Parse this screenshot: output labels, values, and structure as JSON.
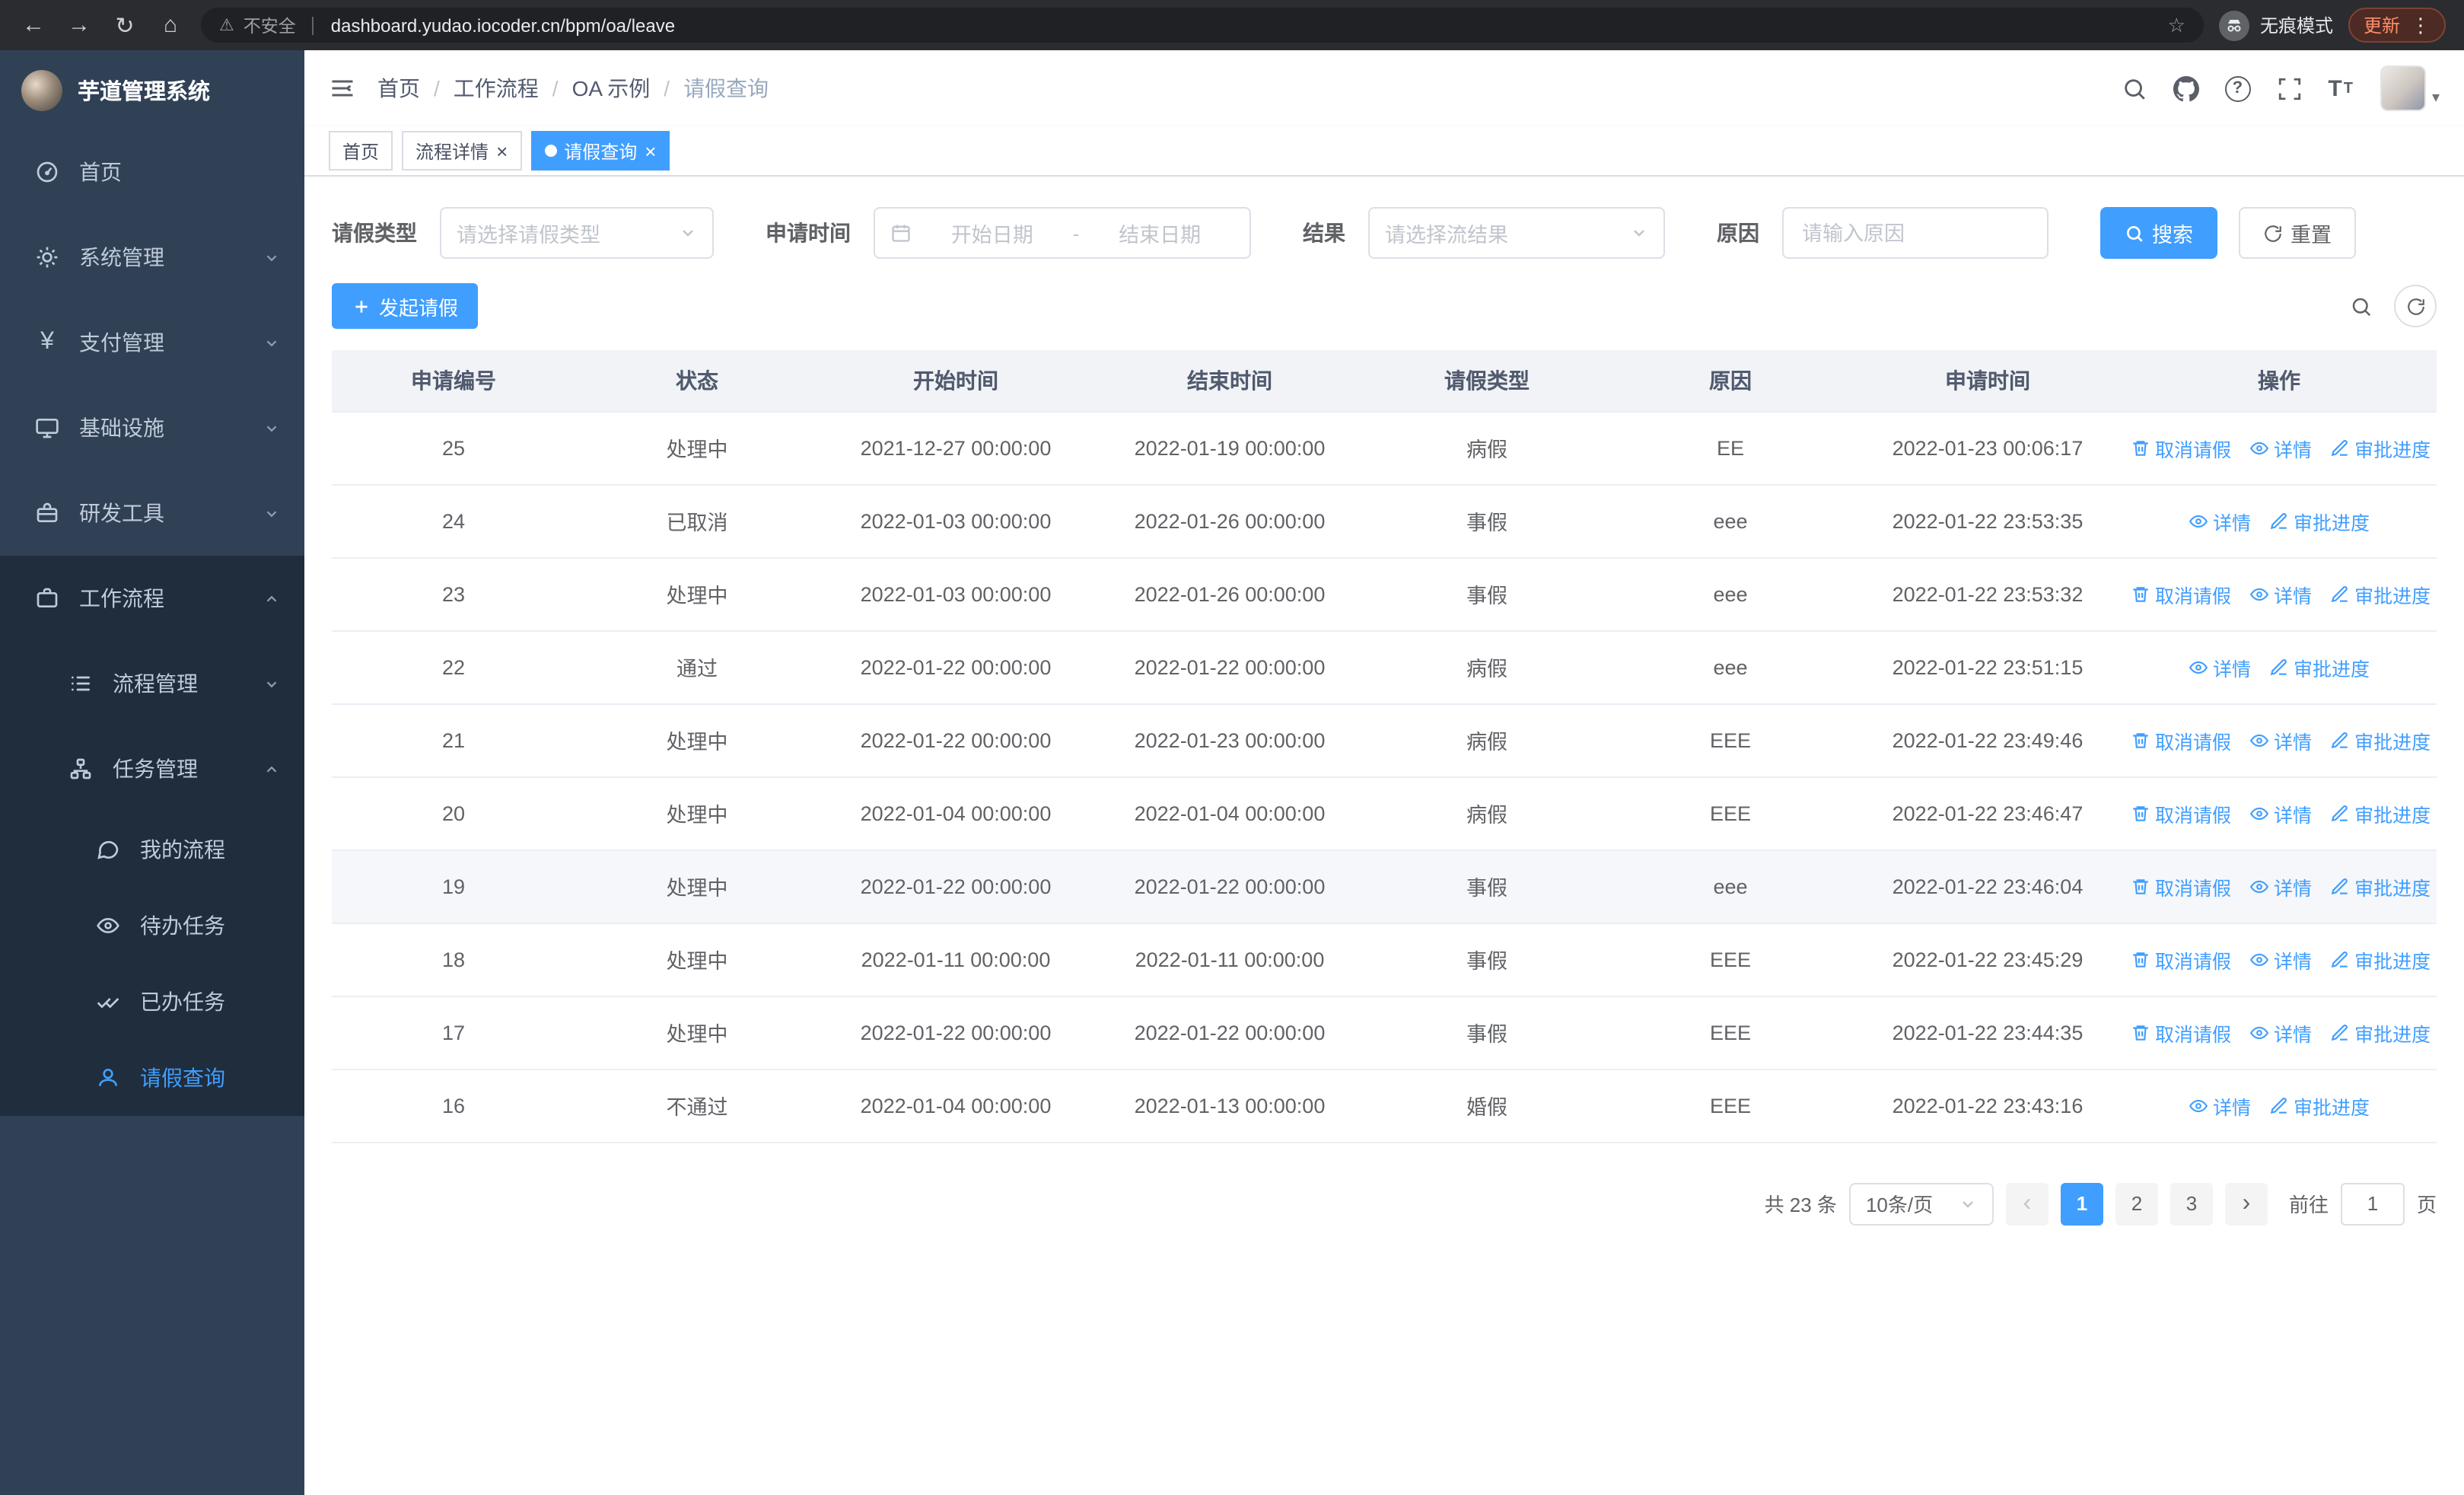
{
  "browser": {
    "warning": "不安全",
    "url": "dashboard.yudao.iocoder.cn/bpm/oa/leave",
    "incognito": "无痕模式",
    "update": "更新"
  },
  "sidebar": {
    "title": "芋道管理系统",
    "items": [
      {
        "label": "首页"
      },
      {
        "label": "系统管理"
      },
      {
        "label": "支付管理"
      },
      {
        "label": "基础设施"
      },
      {
        "label": "研发工具"
      },
      {
        "label": "工作流程"
      },
      {
        "label": "流程管理"
      },
      {
        "label": "任务管理"
      },
      {
        "label": "我的流程"
      },
      {
        "label": "待办任务"
      },
      {
        "label": "已办任务"
      },
      {
        "label": "请假查询"
      }
    ]
  },
  "breadcrumb": [
    "首页",
    "工作流程",
    "OA 示例",
    "请假查询"
  ],
  "tabs": [
    {
      "label": "首页",
      "closable": false,
      "active": false
    },
    {
      "label": "流程详情",
      "closable": true,
      "active": false
    },
    {
      "label": "请假查询",
      "closable": true,
      "active": true
    }
  ],
  "filters": {
    "leave_type_label": "请假类型",
    "leave_type_placeholder": "请选择请假类型",
    "apply_time_label": "申请时间",
    "start_date_placeholder": "开始日期",
    "date_separator": "-",
    "end_date_placeholder": "结束日期",
    "result_label": "结果",
    "result_placeholder": "请选择流结果",
    "reason_label": "原因",
    "reason_placeholder": "请输入原因",
    "search_button": "搜索",
    "reset_button": "重置"
  },
  "toolbar": {
    "create_button": "发起请假"
  },
  "table": {
    "columns": [
      "申请编号",
      "状态",
      "开始时间",
      "结束时间",
      "请假类型",
      "原因",
      "申请时间",
      "操作"
    ],
    "actions": {
      "cancel": "取消请假",
      "detail": "详情",
      "progress": "审批进度"
    },
    "rows": [
      {
        "id": "25",
        "status": "处理中",
        "start": "2021-12-27 00:00:00",
        "end": "2022-01-19 00:00:00",
        "type": "病假",
        "reason": "EE",
        "applied": "2022-01-23 00:06:17",
        "ops": [
          "cancel",
          "detail",
          "progress"
        ],
        "highlight": false
      },
      {
        "id": "24",
        "status": "已取消",
        "start": "2022-01-03 00:00:00",
        "end": "2022-01-26 00:00:00",
        "type": "事假",
        "reason": "eee",
        "applied": "2022-01-22 23:53:35",
        "ops": [
          "detail",
          "progress"
        ],
        "highlight": false
      },
      {
        "id": "23",
        "status": "处理中",
        "start": "2022-01-03 00:00:00",
        "end": "2022-01-26 00:00:00",
        "type": "事假",
        "reason": "eee",
        "applied": "2022-01-22 23:53:32",
        "ops": [
          "cancel",
          "detail",
          "progress"
        ],
        "highlight": false
      },
      {
        "id": "22",
        "status": "通过",
        "start": "2022-01-22 00:00:00",
        "end": "2022-01-22 00:00:00",
        "type": "病假",
        "reason": "eee",
        "applied": "2022-01-22 23:51:15",
        "ops": [
          "detail",
          "progress"
        ],
        "highlight": false
      },
      {
        "id": "21",
        "status": "处理中",
        "start": "2022-01-22 00:00:00",
        "end": "2022-01-23 00:00:00",
        "type": "病假",
        "reason": "EEE",
        "applied": "2022-01-22 23:49:46",
        "ops": [
          "cancel",
          "detail",
          "progress"
        ],
        "highlight": false
      },
      {
        "id": "20",
        "status": "处理中",
        "start": "2022-01-04 00:00:00",
        "end": "2022-01-04 00:00:00",
        "type": "病假",
        "reason": "EEE",
        "applied": "2022-01-22 23:46:47",
        "ops": [
          "cancel",
          "detail",
          "progress"
        ],
        "highlight": false
      },
      {
        "id": "19",
        "status": "处理中",
        "start": "2022-01-22 00:00:00",
        "end": "2022-01-22 00:00:00",
        "type": "事假",
        "reason": "eee",
        "applied": "2022-01-22 23:46:04",
        "ops": [
          "cancel",
          "detail",
          "progress"
        ],
        "highlight": true
      },
      {
        "id": "18",
        "status": "处理中",
        "start": "2022-01-11 00:00:00",
        "end": "2022-01-11 00:00:00",
        "type": "事假",
        "reason": "EEE",
        "applied": "2022-01-22 23:45:29",
        "ops": [
          "cancel",
          "detail",
          "progress"
        ],
        "highlight": false
      },
      {
        "id": "17",
        "status": "处理中",
        "start": "2022-01-22 00:00:00",
        "end": "2022-01-22 00:00:00",
        "type": "事假",
        "reason": "EEE",
        "applied": "2022-01-22 23:44:35",
        "ops": [
          "cancel",
          "detail",
          "progress"
        ],
        "highlight": false
      },
      {
        "id": "16",
        "status": "不通过",
        "start": "2022-01-04 00:00:00",
        "end": "2022-01-13 00:00:00",
        "type": "婚假",
        "reason": "EEE",
        "applied": "2022-01-22 23:43:16",
        "ops": [
          "detail",
          "progress"
        ],
        "highlight": false
      }
    ]
  },
  "pagination": {
    "total_text": "共 23 条",
    "page_size": "10条/页",
    "pages": [
      "1",
      "2",
      "3"
    ],
    "active_page": "1",
    "goto_label": "前往",
    "goto_value": "1",
    "goto_suffix": "页"
  },
  "colors": {
    "primary": "#409eff",
    "sidebar_bg": "#304156",
    "submenu_bg": "#1f2d3d"
  }
}
